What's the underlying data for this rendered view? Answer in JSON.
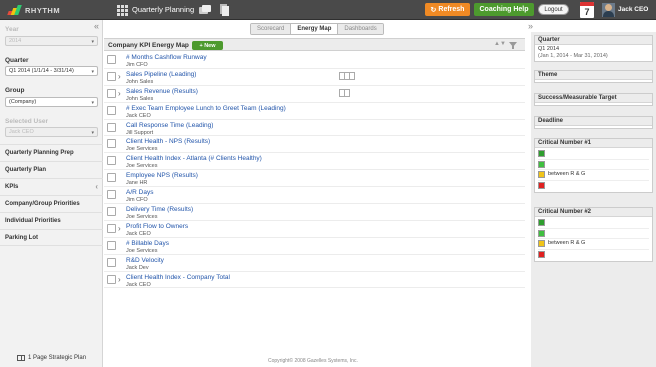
{
  "header": {
    "logo_text": "RHYTHM",
    "app_title": "Quarterly Planning",
    "refresh_label": "Refresh",
    "coaching_label": "Coaching Help",
    "logout_label": "Logout",
    "calendar_day": "7",
    "user_name": "Jack CEO",
    "colors": {
      "refresh": "#f08a24",
      "coaching": "#4d9a2e",
      "bar": "#4a4a4a"
    }
  },
  "sidebar": {
    "year_label": "Year",
    "year_value": "2014",
    "quarter_label": "Quarter",
    "quarter_value": "Q1 2014 (1/1/14 - 3/31/14)",
    "group_label": "Group",
    "group_value": "(Company)",
    "selected_user_label": "Selected User",
    "selected_user_value": "Jack CEO",
    "nav": [
      {
        "label": "Quarterly Planning Prep"
      },
      {
        "label": "Quarterly Plan"
      },
      {
        "label": "KPIs"
      },
      {
        "label": "Company/Group Priorities"
      },
      {
        "label": "Individual Priorities"
      },
      {
        "label": "Parking Lot"
      }
    ],
    "bottom_link": "1 Page Strategic Plan"
  },
  "tabs": [
    {
      "label": "Scorecard",
      "active": false
    },
    {
      "label": "Energy Map",
      "active": true
    },
    {
      "label": "Dashboards",
      "active": false
    }
  ],
  "main": {
    "title": "Company KPI Energy Map",
    "new_button": "+ New",
    "rows": [
      {
        "title": "# Months Cashflow Runway",
        "owner": "Jim CFO",
        "expand": false,
        "boxes": 0
      },
      {
        "title": "Sales Pipeline (Leading)",
        "owner": "John Sales",
        "expand": true,
        "boxes": 3
      },
      {
        "title": "Sales Revenue (Results)",
        "owner": "John Sales",
        "expand": true,
        "boxes": 2
      },
      {
        "title": "# Exec Team Employee Lunch to Greet Team (Leading)",
        "owner": "Jack CEO",
        "expand": false,
        "boxes": 0
      },
      {
        "title": "Call Response Time (Leading)",
        "owner": "Jill Support",
        "expand": false,
        "boxes": 0
      },
      {
        "title": "Client Health - NPS (Results)",
        "owner": "Joe Services",
        "expand": false,
        "boxes": 0
      },
      {
        "title": "Client Health Index - Atlanta (# Clients Healthy)",
        "owner": "Joe Services",
        "expand": false,
        "boxes": 0
      },
      {
        "title": "Employee NPS (Results)",
        "owner": "Jane HR",
        "expand": false,
        "boxes": 0
      },
      {
        "title": "A/R Days",
        "owner": "Jim CFO",
        "expand": false,
        "boxes": 0
      },
      {
        "title": "Delivery Time (Results)",
        "owner": "Joe Services",
        "expand": false,
        "boxes": 0
      },
      {
        "title": "Profit Flow to Owners",
        "owner": "Jack CEO",
        "expand": true,
        "boxes": 0
      },
      {
        "title": "# Billable Days",
        "owner": "Joe Services",
        "expand": false,
        "boxes": 0
      },
      {
        "title": "R&D Velocity",
        "owner": "Jack Dev",
        "expand": false,
        "boxes": 0
      },
      {
        "title": "Client Health Index - Company Total",
        "owner": "Jack CEO",
        "expand": true,
        "boxes": 0
      }
    ],
    "footer": "Copyright© 2008 Gazelles Systems, Inc."
  },
  "right_panel": {
    "quarter_head": "Quarter",
    "quarter_value": "Q1 2014",
    "quarter_range": "(Jan 1, 2014 - Mar 31, 2014)",
    "theme_head": "Theme",
    "target_head": "Success/Measurable Target",
    "deadline_head": "Deadline",
    "cn1_head": "Critical Number #1",
    "cn2_head": "Critical Number #2",
    "tl_colors": [
      "#2e9e2e",
      "#3fbf3f",
      "#f0c419",
      "#e02020"
    ],
    "tl_between_label": "between R & G"
  }
}
